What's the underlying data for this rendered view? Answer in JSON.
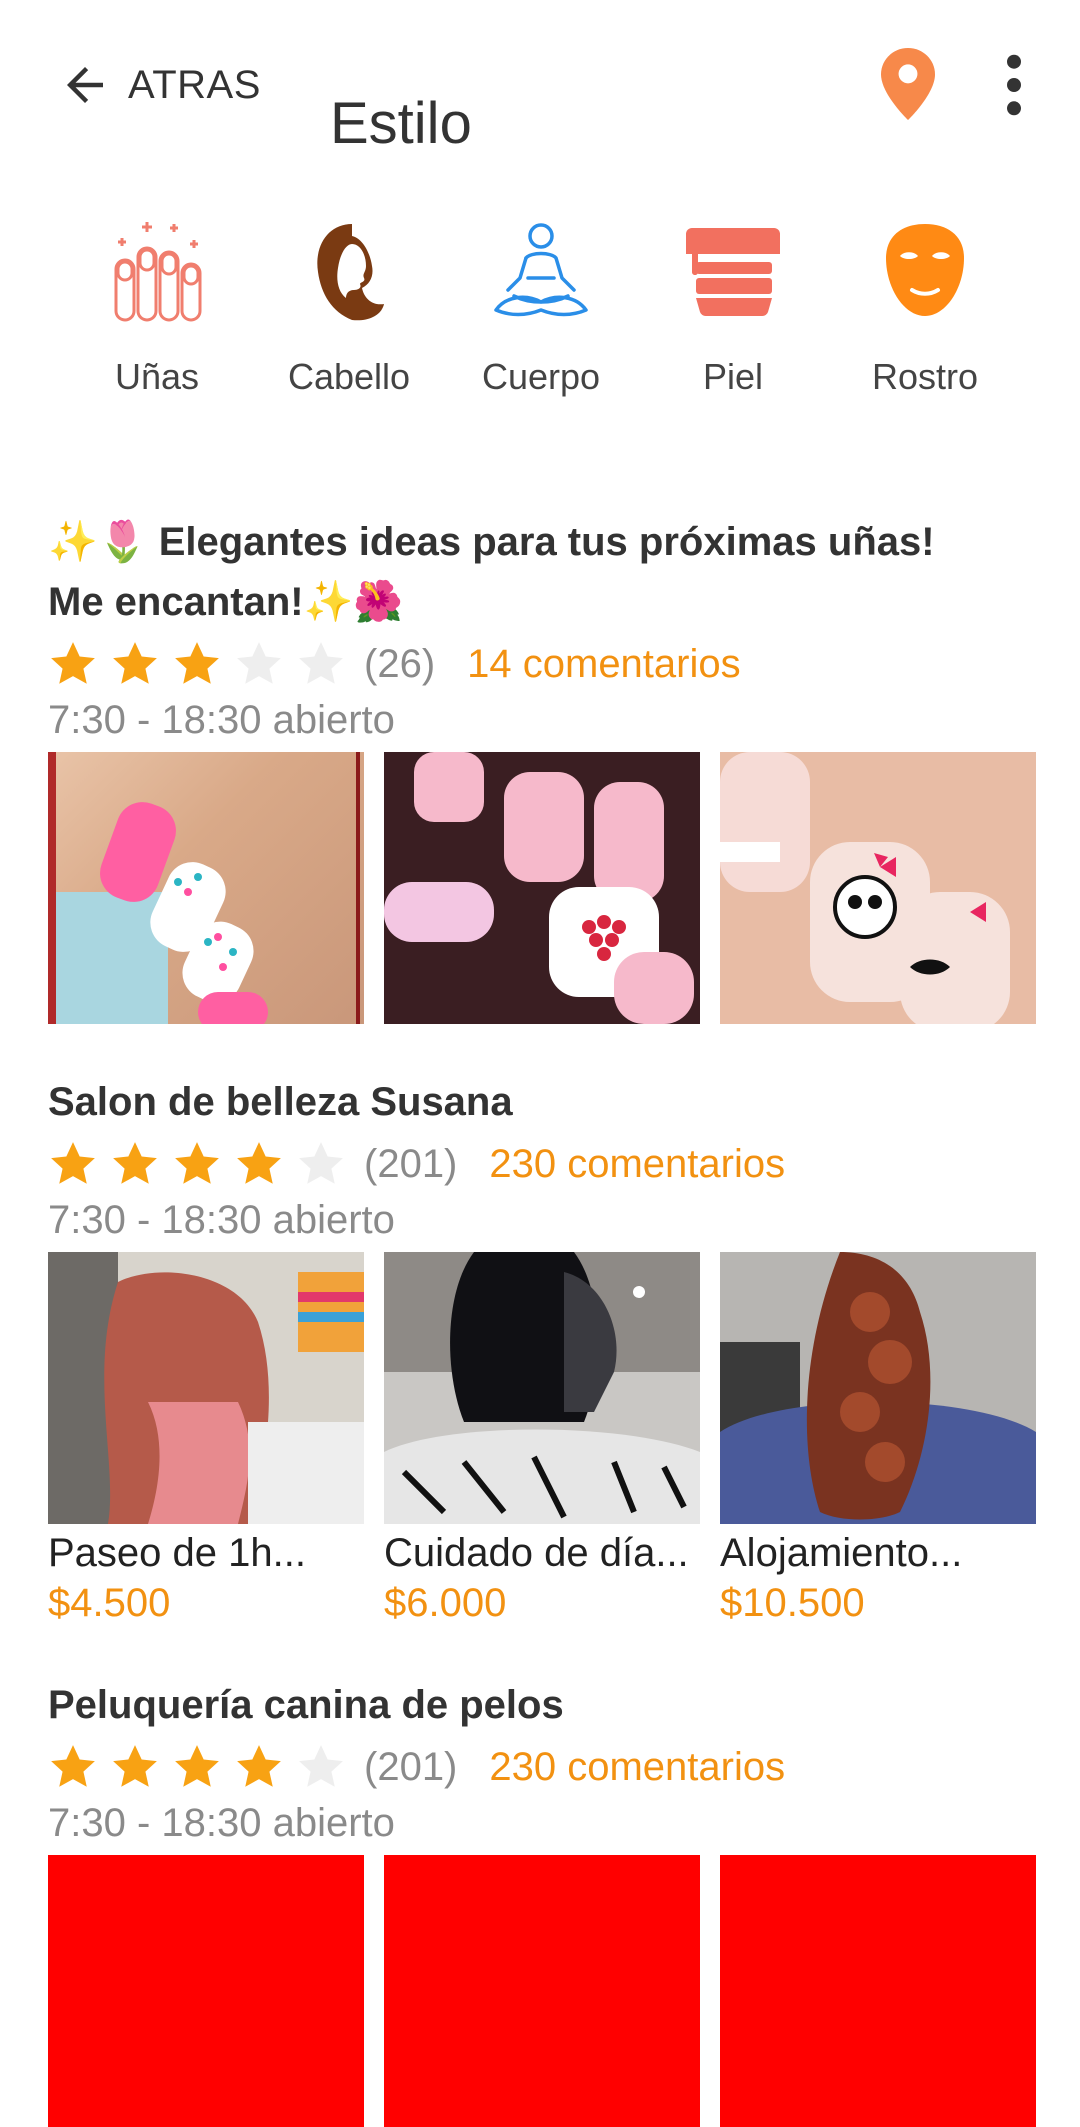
{
  "header": {
    "back_label": "ATRAS",
    "title": "Estilo"
  },
  "categories": [
    {
      "label": "Uñas",
      "icon": "nails-icon"
    },
    {
      "label": "Cabello",
      "icon": "hair-profile-icon"
    },
    {
      "label": "Cuerpo",
      "icon": "meditation-icon"
    },
    {
      "label": "Piel",
      "icon": "cream-jar-icon"
    },
    {
      "label": "Rostro",
      "icon": "face-mask-icon"
    }
  ],
  "sections": [
    {
      "title_line1": "✨🌷 Elegantes ideas para tus próximas uñas!",
      "title_line2": "Me encantan!✨🌺",
      "rating": 3,
      "count": "(26)",
      "comments": "14 comentarios",
      "hours": "7:30 - 18:30 abierto"
    },
    {
      "title": "Salon de belleza Susana",
      "rating": 4,
      "count": "(201)",
      "comments": "230 comentarios",
      "hours": "7:30 - 18:30 abierto",
      "items": [
        {
          "caption": "Paseo de 1h...",
          "price": "$4.500"
        },
        {
          "caption": "Cuidado de día...",
          "price": "$6.000"
        },
        {
          "caption": "Alojamiento...",
          "price": "$10.500"
        }
      ]
    },
    {
      "title": "Peluquería canina de pelos",
      "rating": 4,
      "count": "(201)",
      "comments": "230 comentarios",
      "hours": "7:30 - 18:30 abierto"
    }
  ],
  "colors": {
    "accent": "#f29111",
    "star_on": "#f8a213",
    "star_off": "#eeeeee",
    "placeholder_red": "#ff0000"
  }
}
